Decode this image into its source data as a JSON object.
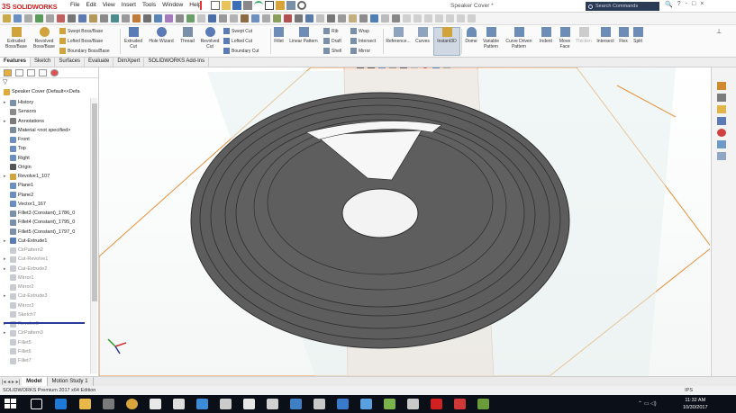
{
  "app": {
    "brand_ds": "3S",
    "brand_name": "SOLIDWORKS",
    "menus": [
      "File",
      "Edit",
      "View",
      "Insert",
      "Tools",
      "Window",
      "Help"
    ],
    "document_title": "Speaker Cover *",
    "search_placeholder": "Search Commands",
    "win_controls": [
      "?",
      "-",
      "□",
      "×"
    ]
  },
  "command_manager": {
    "large": [
      {
        "label": "Extruded Boss/Base",
        "icon": "extrude-boss-icon"
      },
      {
        "label": "Revolved Boss/Base",
        "icon": "revolve-boss-icon"
      },
      {
        "label": "Extruded Cut",
        "icon": "extrude-cut-icon"
      },
      {
        "label": "Hole Wizard",
        "icon": "hole-wizard-icon"
      },
      {
        "label": "Thread",
        "icon": "thread-icon"
      },
      {
        "label": "Revolved Cut",
        "icon": "revolve-cut-icon"
      },
      {
        "label": "Fillet",
        "icon": "fillet-icon"
      },
      {
        "label": "Linear Pattern",
        "icon": "linear-pattern-icon"
      },
      {
        "label": "Reference...",
        "icon": "reference-geometry-icon"
      },
      {
        "label": "Curves",
        "icon": "curves-icon"
      },
      {
        "label": "Instant3D",
        "icon": "instant3d-icon"
      },
      {
        "label": "Dome",
        "icon": "dome-icon"
      },
      {
        "label": "Variable Pattern",
        "icon": "variable-pattern-icon"
      },
      {
        "label": "Curve Driven Pattern",
        "icon": "curve-driven-pattern-icon"
      },
      {
        "label": "Indent",
        "icon": "indent-icon"
      },
      {
        "label": "Move Face",
        "icon": "move-face-icon"
      },
      {
        "label": "Thicken",
        "icon": "thicken-icon"
      },
      {
        "label": "Intersect",
        "icon": "intersect-icon"
      },
      {
        "label": "Flex",
        "icon": "flex-icon"
      },
      {
        "label": "Split",
        "icon": "split-icon"
      }
    ],
    "small_boss": [
      "Swept Boss/Base",
      "Lofted Boss/Base",
      "Boundary Boss/Base"
    ],
    "small_cut": [
      "Swept Cut",
      "Lofted Cut",
      "Boundary Cut"
    ],
    "small_features": [
      "Rib",
      "Draft",
      "Shell",
      "Wrap",
      "Intersect",
      "Mirror"
    ]
  },
  "tabs": [
    "Features",
    "Sketch",
    "Surfaces",
    "Evaluate",
    "DimXpert",
    "SOLIDWORKS Add-Ins"
  ],
  "feature_tree": {
    "root": "Speaker Cover (Default<<Defa",
    "items": [
      {
        "label": "History",
        "icon": "history-icon",
        "grey": false,
        "exp": "▸"
      },
      {
        "label": "Sensors",
        "icon": "sensors-icon",
        "grey": false,
        "exp": ""
      },
      {
        "label": "Annotations",
        "icon": "annotations-icon",
        "grey": false,
        "exp": "▸"
      },
      {
        "label": "Material <not specified>",
        "icon": "material-icon",
        "grey": false,
        "exp": ""
      },
      {
        "label": "Front",
        "icon": "plane-icon",
        "grey": false,
        "exp": ""
      },
      {
        "label": "Top",
        "icon": "plane-icon",
        "grey": false,
        "exp": ""
      },
      {
        "label": "Right",
        "icon": "plane-icon",
        "grey": false,
        "exp": ""
      },
      {
        "label": "Origin",
        "icon": "origin-icon",
        "grey": false,
        "exp": ""
      },
      {
        "label": "Revolve1_107",
        "icon": "revolve-feature-icon",
        "grey": false,
        "exp": "▸"
      },
      {
        "label": "Plane1",
        "icon": "plane-icon",
        "grey": false,
        "exp": ""
      },
      {
        "label": "Plane2",
        "icon": "plane-icon",
        "grey": false,
        "exp": ""
      },
      {
        "label": "Vector1_167",
        "icon": "vector-icon",
        "grey": false,
        "exp": ""
      },
      {
        "label": "Fillet3 (Constant)_1786_0",
        "icon": "fillet-feature-icon",
        "grey": false,
        "exp": ""
      },
      {
        "label": "Fillet4 (Constant)_1795_0",
        "icon": "fillet-feature-icon",
        "grey": false,
        "exp": ""
      },
      {
        "label": "Fillet5 (Constant)_1797_0",
        "icon": "fillet-feature-icon",
        "grey": false,
        "exp": ""
      },
      {
        "label": "Cut-Extrude1",
        "icon": "cut-extrude-icon",
        "grey": false,
        "exp": "▸"
      },
      {
        "label": "CirPattern2",
        "icon": "circular-pattern-icon",
        "grey": true,
        "exp": ""
      },
      {
        "label": "Cut-Revolve1",
        "icon": "cut-revolve-icon",
        "grey": true,
        "exp": "▸"
      },
      {
        "label": "Cut-Extrude2",
        "icon": "cut-extrude-icon",
        "grey": true,
        "exp": "▸"
      },
      {
        "label": "Mirror1",
        "icon": "mirror-icon",
        "grey": true,
        "exp": ""
      },
      {
        "label": "Mirror2",
        "icon": "mirror-icon",
        "grey": true,
        "exp": ""
      },
      {
        "label": "Cut-Extrude3",
        "icon": "cut-extrude-icon",
        "grey": true,
        "exp": "▸"
      },
      {
        "label": "Mirror3",
        "icon": "mirror-icon",
        "grey": true,
        "exp": ""
      },
      {
        "label": "Sketch7",
        "icon": "sketch-icon",
        "grey": true,
        "exp": ""
      },
      {
        "label": "Revolve3",
        "icon": "revolve-feature-icon",
        "grey": true,
        "exp": "▸"
      },
      {
        "label": "CirPattern3",
        "icon": "circular-pattern-icon",
        "grey": true,
        "exp": "▸"
      },
      {
        "label": "Fillet5",
        "icon": "fillet-feature-icon",
        "grey": true,
        "exp": ""
      },
      {
        "label": "Fillet6",
        "icon": "fillet-feature-icon",
        "grey": true,
        "exp": ""
      },
      {
        "label": "Fillet7",
        "icon": "fillet-feature-icon",
        "grey": true,
        "exp": ""
      }
    ]
  },
  "bottom_tabs": [
    "Model",
    "Motion Study 1"
  ],
  "status": {
    "left": "SOLIDWORKS Premium 2017 x64 Edition",
    "units": "IPS"
  },
  "taskbar": {
    "time": "11:32 AM",
    "date": "10/30/2017"
  },
  "colors": {
    "part_gray": "#5d5d5d",
    "plane_orange": "#e8923a",
    "plane_fill": "#f2c8b4",
    "accent_blue": "#2a3a9b"
  }
}
